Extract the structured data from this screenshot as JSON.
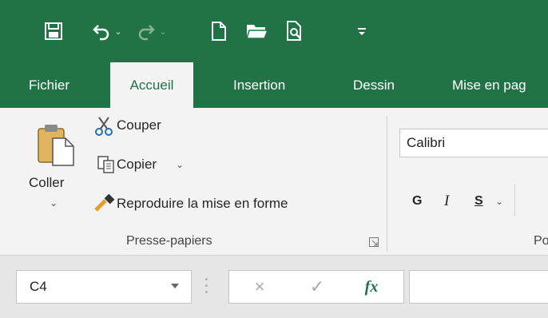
{
  "qat": {
    "save": "save-icon",
    "undo": "undo-icon",
    "redo": "redo-icon",
    "new": "new-document-icon",
    "open": "open-folder-icon",
    "print_preview": "print-preview-icon",
    "customize": "customize-qat-icon"
  },
  "tabs": [
    "Fichier",
    "Accueil",
    "Insertion",
    "Dessin",
    "Mise en pag"
  ],
  "ribbon": {
    "paste": "Coller",
    "cut": "Couper",
    "copy": "Copier",
    "format_painter": "Reproduire la mise en forme",
    "group_clipboard": "Presse-papiers",
    "font_name": "Calibri",
    "bold": "G",
    "italic": "I",
    "underline": "S",
    "group_font_partial": "Po"
  },
  "formula_bar": {
    "name_box": "C4",
    "cancel": "×",
    "enter": "✓",
    "fx": "fx"
  },
  "colors": {
    "accent": "#217346",
    "ribbon_bg": "#f3f3f3"
  }
}
